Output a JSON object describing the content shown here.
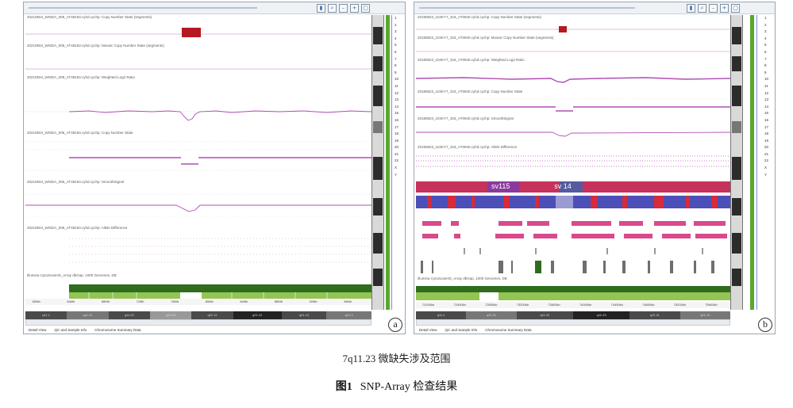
{
  "panel_a": {
    "marker": "a",
    "tracks": [
      "20210504_WISDA_005_AT48183.cyhd.cychp: Copy Number State (segments)",
      "20210504_WISDA_005_AT48183.cyhd.cychp: Mosaic Copy Number State (segments)",
      "20210504_WISDA_005_AT48183.cyhd.cychp: Weighted Log2 Ratio",
      "20210504_WISDA_005_AT48183.cyhd.cychp: Copy Number State",
      "20210504_WISDA_005_AT48183.cyhd.cychp: SmoothSignal",
      "20210504_WISDA_005_AT48183.cyhd.cychp: Allele Difference",
      "Illumina CytoScanHD_Array dbGap, 1000 Genomes, DB"
    ],
    "axis_ticks": [
      "60Mb",
      "64Mb",
      "68Mb",
      "72Mb",
      "76Mb",
      "80Mb",
      "84Mb",
      "88Mb",
      "92Mb",
      "96Mb"
    ],
    "position_bands": [
      "q11.1",
      "q11.21",
      "q11.22",
      "q11.23",
      "q21.11",
      "q21.12",
      "q21.13",
      "q21.3"
    ],
    "tabs": [
      "Detail View",
      "QC and Sample Info",
      "Chromosome Summary Data"
    ],
    "side_numbers": [
      "1",
      "2",
      "3",
      "4",
      "5",
      "6",
      "7",
      "8",
      "9",
      "10",
      "11",
      "12",
      "13",
      "14",
      "15",
      "16",
      "17",
      "18",
      "19",
      "20",
      "21",
      "22",
      "X",
      "Y"
    ]
  },
  "panel_b": {
    "marker": "b",
    "tracks": [
      "20180823_104KY7_318_AT0940.cyhd.cychp: Copy Number State (segments)",
      "20180823_104KY7_318_AT0940.cyhd.cychp: Mosaic Copy Number State (segments)",
      "20180823_104KY7_318_AT0940.cyhd.cychp: Weighted Log2 Ratio",
      "20180823_104KY7_318_AT0940.cyhd.cychp: Copy Number State",
      "20180823_104KY7_318_AT0940.cyhd.cychp: SmoothSignal",
      "20180823_104KY7_318_AT0940.cyhd.cychp: Allele Difference",
      "Illumina CytoScanHD_Array dbGap, 1000 Genomes, DB"
    ],
    "band_labels": [
      "sv115",
      "sv 14"
    ],
    "axis_ticks": [
      "72000kb",
      "72400kb",
      "72800kb",
      "73200kb",
      "73600kb",
      "74000kb",
      "74400kb",
      "74800kb",
      "75200kb",
      "75600kb"
    ],
    "position_bands": [
      "q11.1",
      "q11.21",
      "q11.22",
      "q11.23",
      "q21.11",
      "q21.12"
    ],
    "tabs": [
      "Detail View",
      "QC and Sample Info",
      "Chromosome Summary Data"
    ],
    "side_numbers": [
      "1",
      "2",
      "3",
      "4",
      "5",
      "6",
      "7",
      "8",
      "9",
      "10",
      "11",
      "12",
      "13",
      "14",
      "15",
      "16",
      "17",
      "18",
      "19",
      "20",
      "21",
      "22",
      "X",
      "Y"
    ]
  },
  "caption": {
    "sub": "7q11.23 微缺失涉及范围",
    "figure_num": "图1",
    "title": "SNP-Array 检查结果"
  },
  "colors": {
    "track_line": "#b04fb4",
    "deletion_block": "#b3191f",
    "green_dark": "#2f6d1c",
    "green_light": "#93c454"
  }
}
